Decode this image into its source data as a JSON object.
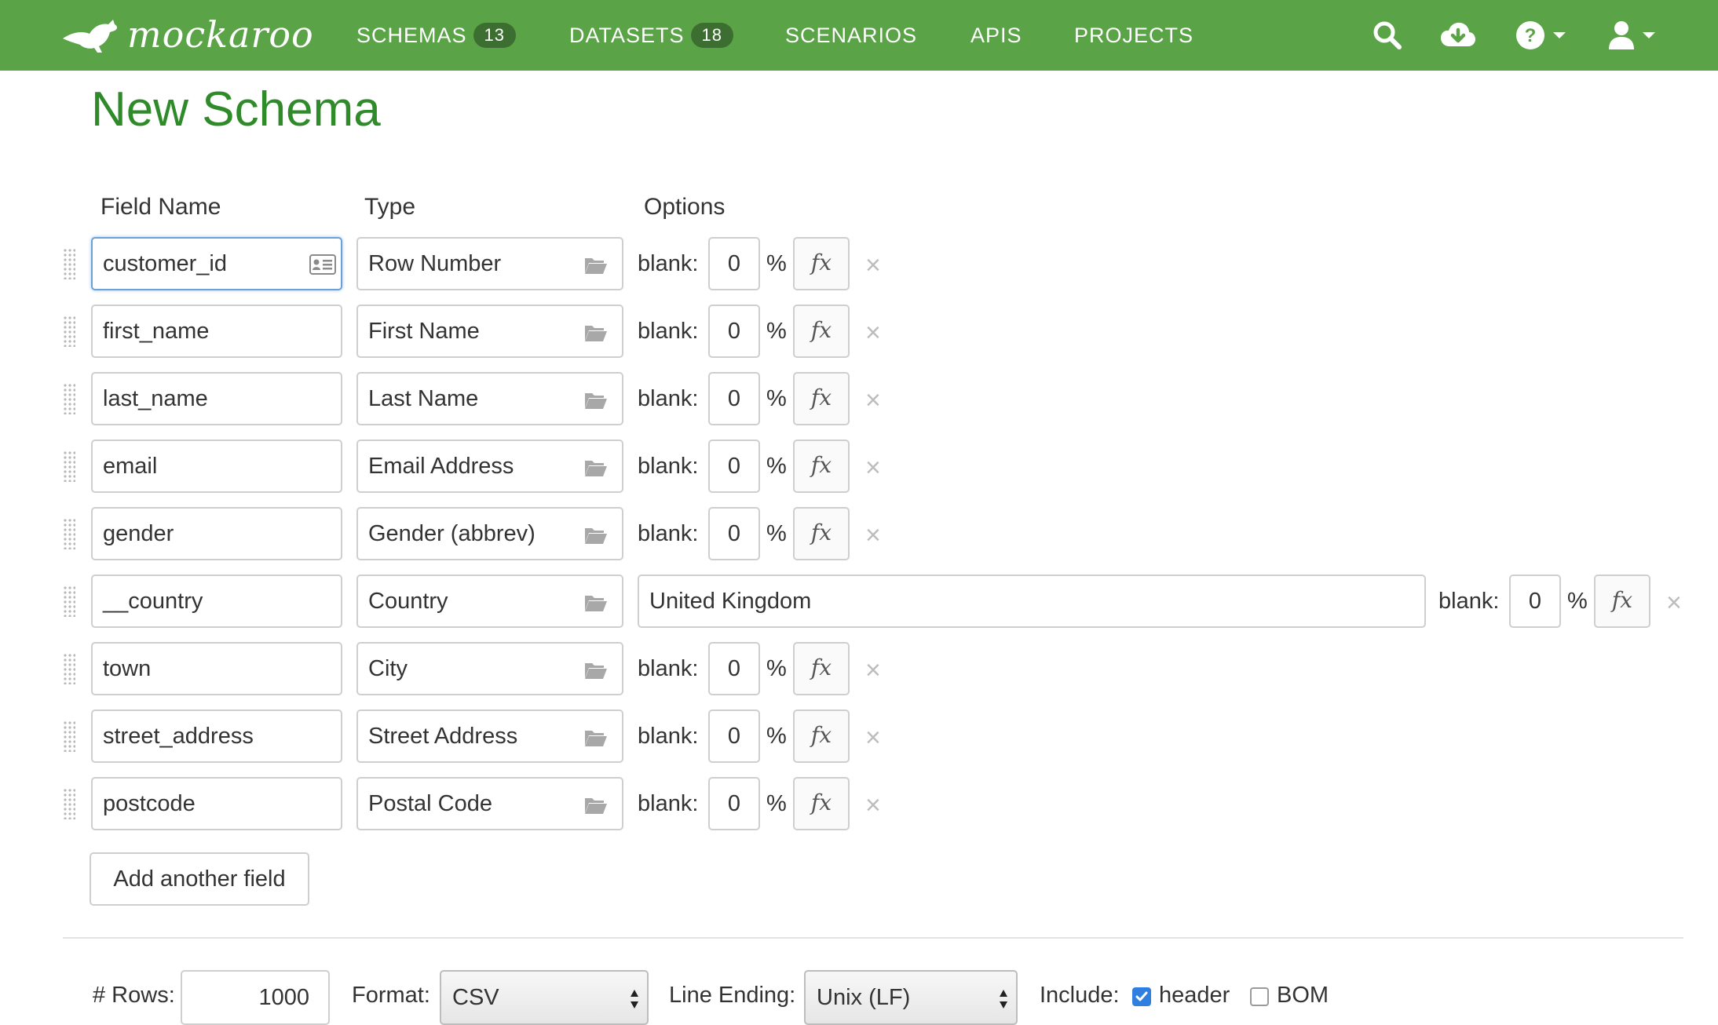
{
  "nav": {
    "brand": "mockaroo",
    "items": [
      {
        "label": "SCHEMAS",
        "badge": "13"
      },
      {
        "label": "DATASETS",
        "badge": "18"
      },
      {
        "label": "SCENARIOS"
      },
      {
        "label": "APIS"
      },
      {
        "label": "PROJECTS"
      }
    ],
    "icons": [
      "search-icon",
      "cloud-download-icon",
      "help-icon",
      "user-icon"
    ]
  },
  "page": {
    "title": "New Schema"
  },
  "columns": {
    "field_name": "Field Name",
    "type": "Type",
    "options": "Options"
  },
  "fields": [
    {
      "name": "customer_id",
      "type": "Row Number",
      "blank_label": "blank:",
      "blank": "0",
      "percent": "%",
      "fx": "fx"
    },
    {
      "name": "first_name",
      "type": "First Name",
      "blank_label": "blank:",
      "blank": "0",
      "percent": "%",
      "fx": "fx"
    },
    {
      "name": "last_name",
      "type": "Last Name",
      "blank_label": "blank:",
      "blank": "0",
      "percent": "%",
      "fx": "fx"
    },
    {
      "name": "email",
      "type": "Email Address",
      "blank_label": "blank:",
      "blank": "0",
      "percent": "%",
      "fx": "fx"
    },
    {
      "name": "gender",
      "type": "Gender (abbrev)",
      "blank_label": "blank:",
      "blank": "0",
      "percent": "%",
      "fx": "fx"
    },
    {
      "name": "__country",
      "type": "Country",
      "option_value": "United Kingdom",
      "blank_label": "blank:",
      "blank": "0",
      "percent": "%",
      "fx": "fx"
    },
    {
      "name": "town",
      "type": "City",
      "blank_label": "blank:",
      "blank": "0",
      "percent": "%",
      "fx": "fx"
    },
    {
      "name": "street_address",
      "type": "Street Address",
      "blank_label": "blank:",
      "blank": "0",
      "percent": "%",
      "fx": "fx"
    },
    {
      "name": "postcode",
      "type": "Postal Code",
      "blank_label": "blank:",
      "blank": "0",
      "percent": "%",
      "fx": "fx"
    }
  ],
  "remove_symbol": "×",
  "add_field_label": "Add another field",
  "bottom": {
    "rows_label": "# Rows:",
    "rows_value": "1000",
    "format_label": "Format:",
    "format_value": "CSV",
    "line_ending_label": "Line Ending:",
    "line_ending_value": "Unix (LF)",
    "include_label": "Include:",
    "header_label": "header",
    "header_checked": true,
    "bom_label": "BOM",
    "bom_checked": false
  },
  "colors": {
    "navbar": "#5aa447",
    "title": "#2f8a2a",
    "badge": "#3c6e31",
    "checkbox": "#2f7fe0"
  }
}
